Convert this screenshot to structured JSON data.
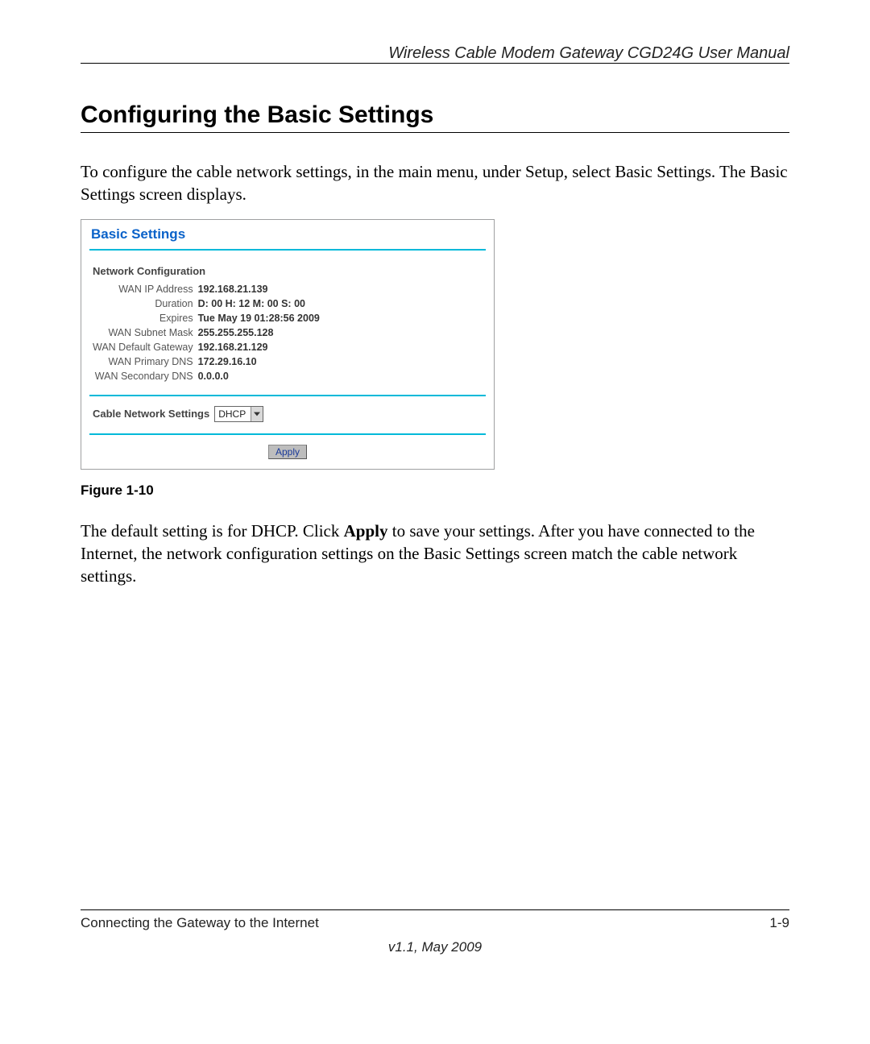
{
  "header": {
    "running_head": "Wireless Cable Modem Gateway CGD24G User Manual"
  },
  "section": {
    "title": "Configuring the Basic Settings",
    "intro": "To configure the cable network settings, in the main menu, under Setup, select Basic Settings. The Basic Settings screen displays."
  },
  "figure": {
    "caption": "Figure 1-10",
    "panel_title": "Basic Settings",
    "netconf_title": "Network Configuration",
    "rows": [
      {
        "key": "WAN IP Address",
        "val": "192.168.21.139"
      },
      {
        "key": "Duration",
        "val": "D: 00 H: 12 M: 00 S: 00"
      },
      {
        "key": "Expires",
        "val": "Tue May 19 01:28:56 2009"
      },
      {
        "key": "WAN Subnet Mask",
        "val": "255.255.255.128"
      },
      {
        "key": "WAN Default Gateway",
        "val": "192.168.21.129"
      },
      {
        "key": "WAN Primary DNS",
        "val": "172.29.16.10"
      },
      {
        "key": "WAN Secondary DNS",
        "val": "0.0.0.0"
      }
    ],
    "cable_label": "Cable Network Settings",
    "cable_select_value": "DHCP",
    "apply_label": "Apply"
  },
  "after_figure": {
    "p1_prefix": "The default setting is for DHCP. Click ",
    "p1_bold": "Apply",
    "p1_suffix": " to save your settings. After you have connected to the Internet, the network configuration settings on the Basic Settings screen match the cable network settings."
  },
  "footer": {
    "left": "Connecting the Gateway to the Internet",
    "right": "1-9",
    "version": "v1.1, May 2009"
  }
}
